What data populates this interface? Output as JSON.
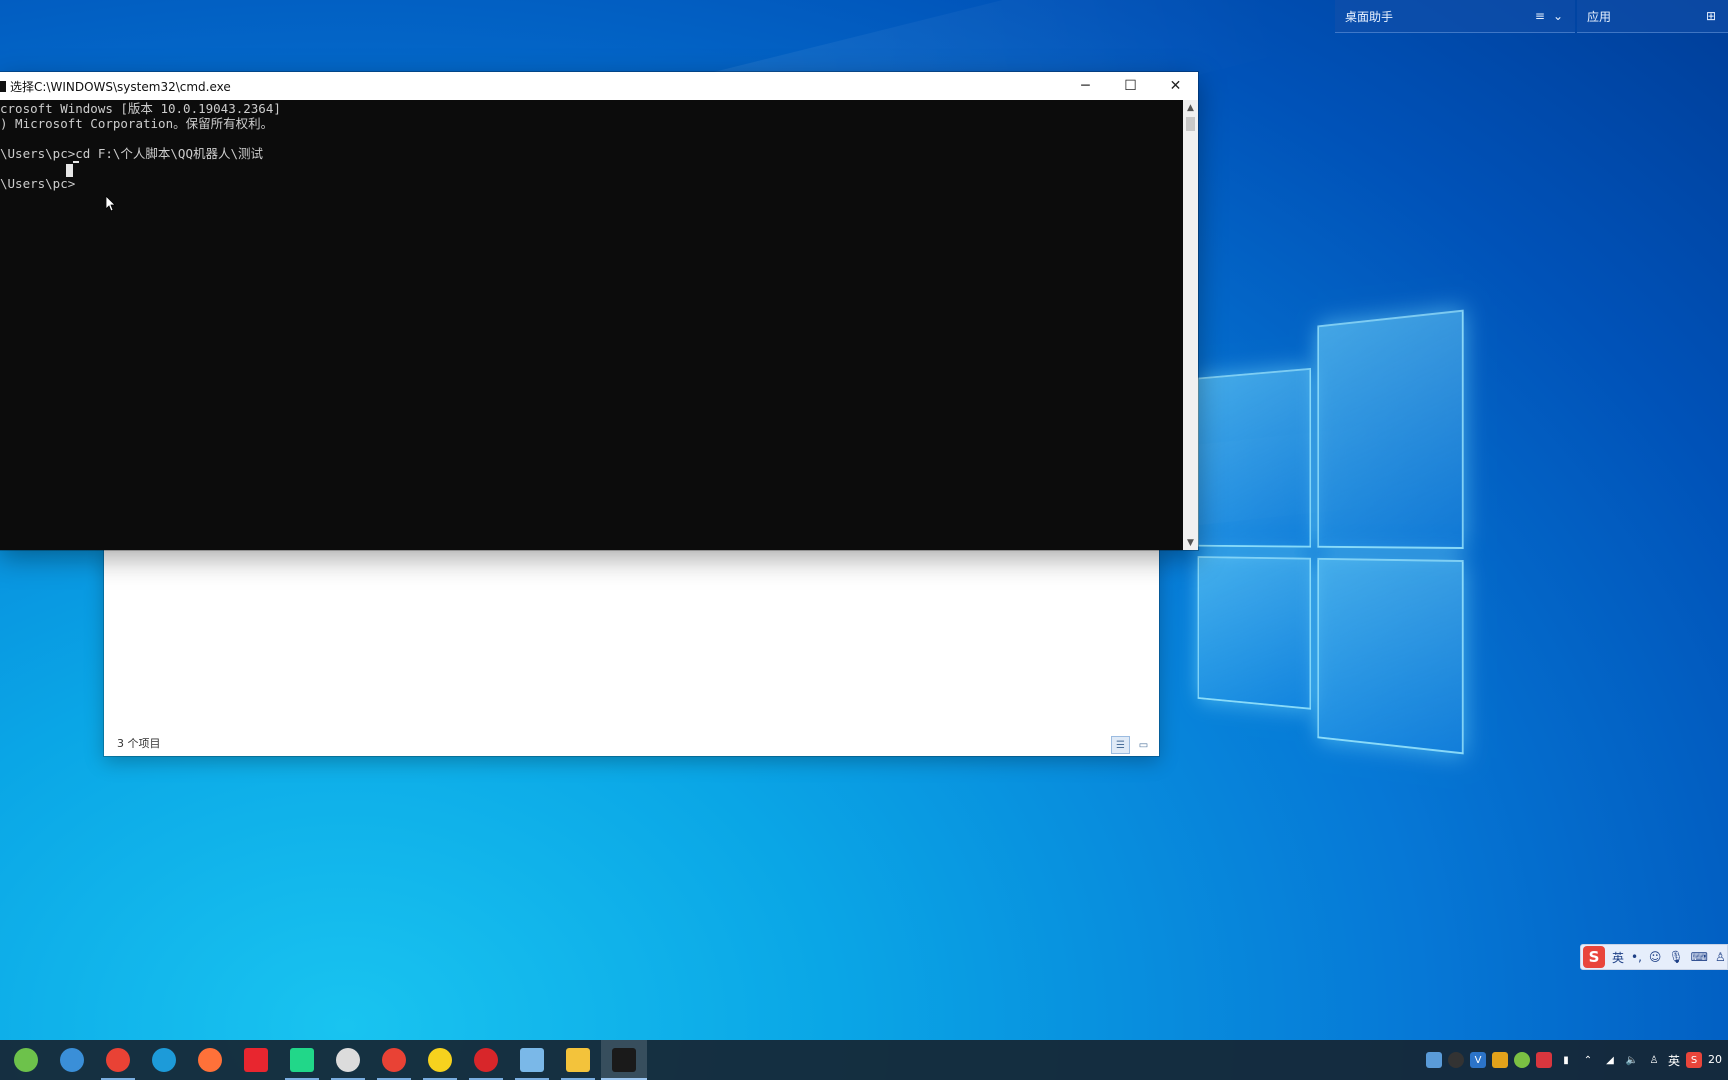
{
  "desktop": {
    "widget_left_title": "桌面助手",
    "widget_right_title": "应用"
  },
  "cmd_window": {
    "title": "选择C:\\WINDOWS\\system32\\cmd.exe",
    "lines": [
      "crosoft Windows [版本 10.0.19043.2364]",
      ") Microsoft Corporation。保留所有权利。",
      "",
      "\\Users\\pc>cd F:\\个人脚本\\QQ机器人\\测试",
      "",
      "\\Users\\pc>"
    ],
    "minimize_glyph": "─",
    "maximize_glyph": "☐",
    "close_glyph": "✕"
  },
  "explorer_window": {
    "status_text": "3 个项目"
  },
  "ime": {
    "logo": "S",
    "mode": "英",
    "punct": "•,"
  },
  "taskbar": {
    "apps": [
      {
        "name": "desktop-organizer",
        "color": "#6dc24b",
        "running": false
      },
      {
        "name": "network-tool",
        "color": "#3a8fd8",
        "running": false
      },
      {
        "name": "chrome",
        "color": "#e94235",
        "running": true
      },
      {
        "name": "edge",
        "color": "#1d9bd9",
        "running": false
      },
      {
        "name": "firefox",
        "color": "#ff7139",
        "running": false
      },
      {
        "name": "youdao-dictionary",
        "color": "#e8262f",
        "running": false
      },
      {
        "name": "pycharm",
        "color": "#21d789",
        "running": true
      },
      {
        "name": "obs-like-app",
        "color": "#dcdcdc",
        "running": true
      },
      {
        "name": "chrome-2",
        "color": "#e94235",
        "running": true
      },
      {
        "name": "qq-music",
        "color": "#f6d21e",
        "running": true
      },
      {
        "name": "recorder",
        "color": "#d8262a",
        "running": true
      },
      {
        "name": "image-viewer",
        "color": "#7ab8e8",
        "running": true
      },
      {
        "name": "file-explorer",
        "color": "#f3c33b",
        "running": true
      },
      {
        "name": "command-prompt",
        "color": "#1a1a1a",
        "running": true,
        "active": true
      }
    ],
    "tray_lang": "英",
    "clock_partial": "20"
  }
}
